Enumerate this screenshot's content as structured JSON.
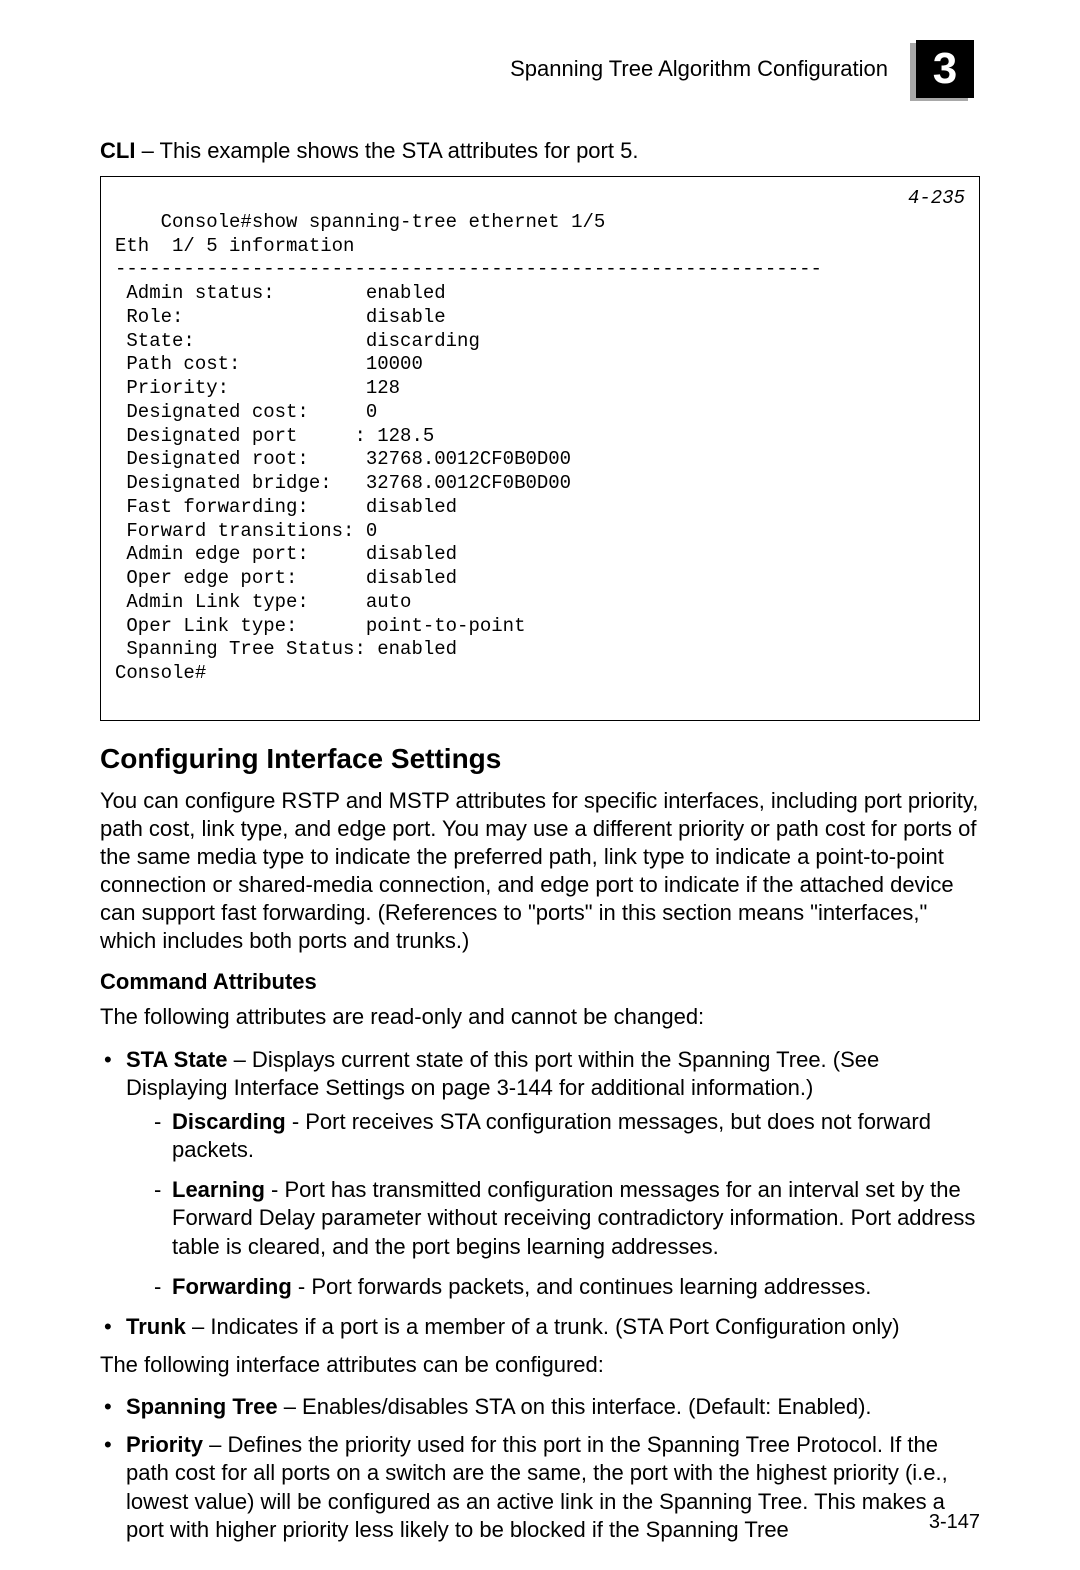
{
  "header": {
    "title": "Spanning Tree Algorithm Configuration",
    "chapter": "3"
  },
  "intro": {
    "label": "CLI",
    "text": " – This example shows the STA attributes for port 5."
  },
  "cli": {
    "page_ref": "4-235",
    "lines": "Console#show spanning-tree ethernet 1/5\nEth  1/ 5 information\n--------------------------------------------------------------\n Admin status:        enabled\n Role:                disable\n State:               discarding\n Path cost:           10000\n Priority:            128\n Designated cost:     0\n Designated port     : 128.5\n Designated root:     32768.0012CF0B0D00\n Designated bridge:   32768.0012CF0B0D00\n Fast forwarding:     disabled\n Forward transitions: 0\n Admin edge port:     disabled\n Oper edge port:      disabled\n Admin Link type:     auto\n Oper Link type:      point-to-point\n Spanning Tree Status: enabled\nConsole#"
  },
  "section": {
    "title": "Configuring Interface Settings",
    "body": "You can configure RSTP and MSTP attributes for specific interfaces, including port priority, path cost, link type, and edge port. You may use a different priority or path cost for ports of the same media type to indicate the preferred path, link type to indicate a point-to-point connection or shared-media connection, and edge port to indicate if the attached device can support fast forwarding. (References to \"ports\" in this section means \"interfaces,\" which includes both ports and trunks.)"
  },
  "command_attributes": {
    "heading": "Command Attributes",
    "intro1": "The following attributes are read-only and cannot be changed:",
    "sta_state_label": "STA State",
    "sta_state_text": " – Displays current state of this port within the Spanning Tree. (See Displaying Interface Settings on page 3-144 for additional information.)",
    "discarding_label": "Discarding",
    "discarding_text": " - Port receives STA configuration messages, but does not forward packets.",
    "learning_label": "Learning",
    "learning_text": " - Port has transmitted configuration messages for an interval set by the Forward Delay parameter without receiving contradictory information. Port address table is cleared, and the port begins learning addresses.",
    "forwarding_label": "Forwarding",
    "forwarding_text": " - Port forwards packets, and continues learning addresses.",
    "trunk_label": "Trunk",
    "trunk_text": " – Indicates if a port is a member of a trunk. (STA Port Configuration only)",
    "intro2": "The following interface attributes can be configured:",
    "spanning_tree_label": "Spanning Tree",
    "spanning_tree_text": " – Enables/disables STA on this interface. (Default: Enabled).",
    "priority_label": "Priority",
    "priority_text": " – Defines the priority used for this port in the Spanning Tree Protocol. If the path cost for all ports on a switch are the same, the port with the highest priority (i.e., lowest value) will be configured as an active link in the Spanning Tree. This makes a port with higher priority less likely to be blocked if the Spanning Tree"
  },
  "page_number": "3-147"
}
